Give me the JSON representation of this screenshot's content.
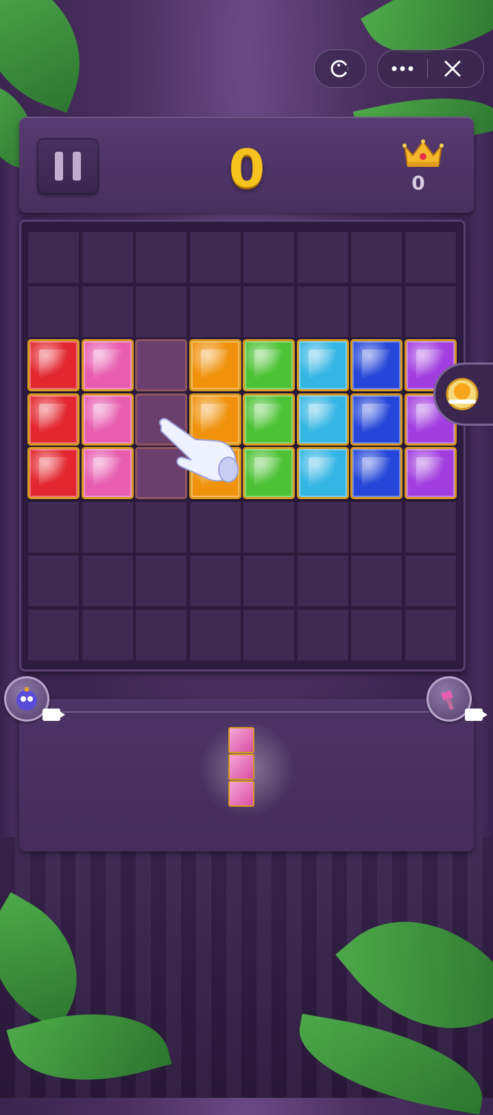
{
  "header": {
    "score": "0",
    "best_score": "0"
  },
  "topbar": {
    "icons": [
      "pacman-icon",
      "more-icon",
      "close-icon"
    ]
  },
  "board": {
    "rows": 8,
    "cols": 8,
    "gems": [
      [
        "",
        "",
        "",
        "",
        "",
        "",
        "",
        ""
      ],
      [
        "",
        "",
        "",
        "",
        "",
        "",
        "",
        ""
      ],
      [
        "red",
        "pink",
        "ghost",
        "orange",
        "green",
        "cyan",
        "blue",
        "purple"
      ],
      [
        "red",
        "pink",
        "ghost",
        "orange",
        "green",
        "cyan",
        "blue",
        "purple"
      ],
      [
        "red",
        "pink",
        "ghost",
        "orange",
        "green",
        "cyan",
        "blue",
        "purple"
      ],
      [
        "",
        "",
        "",
        "",
        "",
        "",
        "",
        ""
      ],
      [
        "",
        "",
        "",
        "",
        "",
        "",
        "",
        ""
      ],
      [
        "",
        "",
        "",
        "",
        "",
        "",
        "",
        ""
      ]
    ]
  },
  "tray": {
    "piece": {
      "color": "pink",
      "length": 3,
      "orientation": "vertical"
    }
  },
  "boosters": {
    "left": "bomb-booster-icon",
    "right": "hammer-booster-icon"
  },
  "colors": {
    "red": "#e3262f",
    "pink": "#e85db0",
    "orange": "#f0920c",
    "green": "#4cc234",
    "cyan": "#34b6e4",
    "blue": "#2546d8",
    "purple": "#a23ee0",
    "score": "#f6c21e"
  }
}
